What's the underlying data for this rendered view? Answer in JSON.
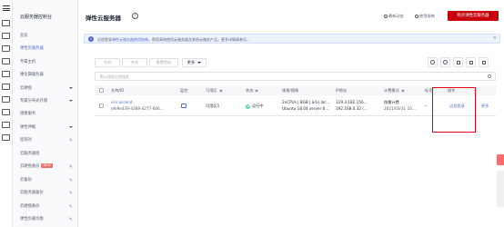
{
  "sidebar": {
    "title": "云服务器控制台",
    "items": [
      {
        "label": "总览",
        "active": false,
        "kind": "plain"
      },
      {
        "label": "弹性云服务器",
        "active": true,
        "kind": "plain"
      },
      {
        "label": "专属主机",
        "active": false,
        "kind": "plain"
      },
      {
        "label": "裸金属服务器",
        "active": false,
        "kind": "plain"
      },
      {
        "label": "云硬盘",
        "active": false,
        "kind": "caret"
      },
      {
        "label": "专属分布式存储",
        "active": false,
        "kind": "caret"
      },
      {
        "label": "镜像服务",
        "active": false,
        "kind": "plain"
      },
      {
        "label": "弹性伸缩",
        "active": false,
        "kind": "caret"
      },
      {
        "label": "密钥对",
        "active": false,
        "kind": "edit"
      },
      {
        "label": "云服务器组",
        "active": false,
        "kind": "plain"
      },
      {
        "label": "云硬盘备份",
        "active": false,
        "kind": "edit",
        "badge": "NEW"
      },
      {
        "label": "云备份",
        "active": false,
        "kind": "edit"
      },
      {
        "label": "云服务器备份",
        "active": false,
        "kind": "edit"
      },
      {
        "label": "云硬盘备份",
        "active": false,
        "kind": "edit"
      },
      {
        "label": "弹性负载均衡",
        "active": false,
        "kind": "edit"
      }
    ]
  },
  "header": {
    "title": "弹性云服务器",
    "help": "?",
    "link1": "最新动态",
    "link2": "使用指南",
    "buy_button": "购买弹性云服务器"
  },
  "notice": {
    "text_pre": "远程登录",
    "link": "弹性云服务器使用指南",
    "text_post": "，帮您高效使用云服务器及其他云服务产品，更多详情请参见…",
    "close": "×"
  },
  "toolbar": {
    "start": "开机",
    "stop": "关机",
    "reset_pwd": "重置密码",
    "more": "更多"
  },
  "search": {
    "placeholder": "默认按照名称搜索"
  },
  "table": {
    "headers": {
      "name": "名称/ID",
      "monitor": "监控",
      "az": "可用区",
      "status": "状态",
      "spec": "规格/镜像",
      "ip": "IP地址",
      "billing": "计费模式",
      "tag": "标签",
      "op": "操作"
    },
    "row": {
      "name": "ecs-ascend",
      "id": "efe9e439-4389-4277-666…",
      "az": "可用区1",
      "status": "运行中",
      "spec1": "2vCPUs | 8GB | ai1s.lar…",
      "spec2": "Ubuntu 18.04 server 6…",
      "ip1": "119.3.182.156…",
      "ip2": "192.168.0.32 (…",
      "billing1": "按需计费",
      "billing2": "2021/03/31 16…",
      "tag": "--",
      "op1": "远程登录",
      "op2": "更多"
    }
  },
  "colors": {
    "accent": "#526ecc",
    "buy": "#c7000b",
    "running": "#50d4ab",
    "highlight": "#e60012"
  }
}
